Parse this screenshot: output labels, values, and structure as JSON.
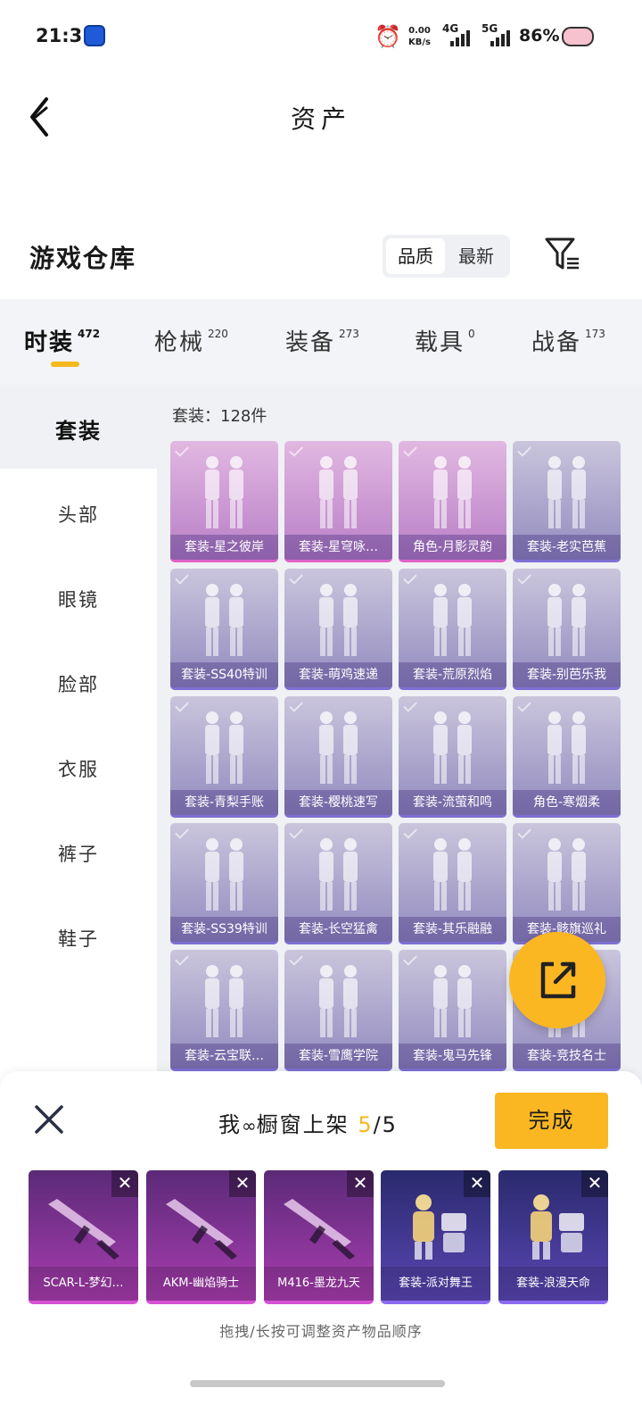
{
  "status_bar": {
    "time": "21:31",
    "net_speed_value": "0.00",
    "net_speed_unit": "KB/s",
    "network_1": "4G",
    "network_2": "5G",
    "battery": "86%",
    "icons": [
      "app-icon",
      "alarm-icon",
      "signal-icon",
      "battery-pig-icon"
    ]
  },
  "header": {
    "title": "资产",
    "back_icon": "back-chevron-icon"
  },
  "warehouse": {
    "title": "游戏仓库",
    "sort_options": [
      "品质",
      "最新"
    ],
    "selected_sort": "品质",
    "filter_icon": "filter-icon"
  },
  "tabs": [
    {
      "label": "时装",
      "count": "472",
      "active": true
    },
    {
      "label": "枪械",
      "count": "220",
      "active": false
    },
    {
      "label": "装备",
      "count": "273",
      "active": false
    },
    {
      "label": "载具",
      "count": "0",
      "active": false
    },
    {
      "label": "战备",
      "count": "173",
      "active": false
    }
  ],
  "sidebar": {
    "items": [
      "套装",
      "头部",
      "眼镜",
      "脸部",
      "衣服",
      "裤子",
      "鞋子"
    ],
    "selected": "套装"
  },
  "grid": {
    "count_label": "套装：128件",
    "items": [
      {
        "label": "套装-星之彼岸",
        "rarity": "pink"
      },
      {
        "label": "套装-星穹咏…",
        "rarity": "pink"
      },
      {
        "label": "角色-月影灵韵",
        "rarity": "pink"
      },
      {
        "label": "套装-老实芭蕉",
        "rarity": "violet"
      },
      {
        "label": "套装-SS40特训",
        "rarity": "violet"
      },
      {
        "label": "套装-萌鸡速递",
        "rarity": "violet"
      },
      {
        "label": "套装-荒原烈焰",
        "rarity": "violet"
      },
      {
        "label": "套装-别芭乐我",
        "rarity": "violet"
      },
      {
        "label": "套装-青梨手账",
        "rarity": "violet"
      },
      {
        "label": "套装-樱桃速写",
        "rarity": "violet"
      },
      {
        "label": "套装-流萤和鸣",
        "rarity": "violet"
      },
      {
        "label": "角色-寒烟柔",
        "rarity": "violet"
      },
      {
        "label": "套装-SS39特训",
        "rarity": "violet"
      },
      {
        "label": "套装-长空猛禽",
        "rarity": "violet"
      },
      {
        "label": "套装-其乐融融",
        "rarity": "violet"
      },
      {
        "label": "套装-骸旗巡礼",
        "rarity": "violet"
      },
      {
        "label": "套装-云宝联…",
        "rarity": "violet"
      },
      {
        "label": "套装-雪鹰学院",
        "rarity": "violet"
      },
      {
        "label": "套装-鬼马先锋",
        "rarity": "violet"
      },
      {
        "label": "套装-竞技名士",
        "rarity": "violet"
      }
    ],
    "share_icon": "share-export-icon"
  },
  "shelf": {
    "title_prefix": "我",
    "title_mid": "橱窗上架",
    "current": "5",
    "total": "/5",
    "done_label": "完成",
    "slots": [
      {
        "label": "SCAR-L-梦幻…",
        "type": "gun"
      },
      {
        "label": "AKM-幽焰骑士",
        "type": "gun"
      },
      {
        "label": "M416-墨龙九天",
        "type": "gun"
      },
      {
        "label": "套装-派对舞王",
        "type": "suit"
      },
      {
        "label": "套装-浪漫天命",
        "type": "suit"
      }
    ],
    "hint": "拖拽/长按可调整资产物品顺序"
  },
  "colors": {
    "accent": "#fbb722",
    "pink_rarity": "#e062c9",
    "violet_rarity": "#7d6fd3"
  }
}
